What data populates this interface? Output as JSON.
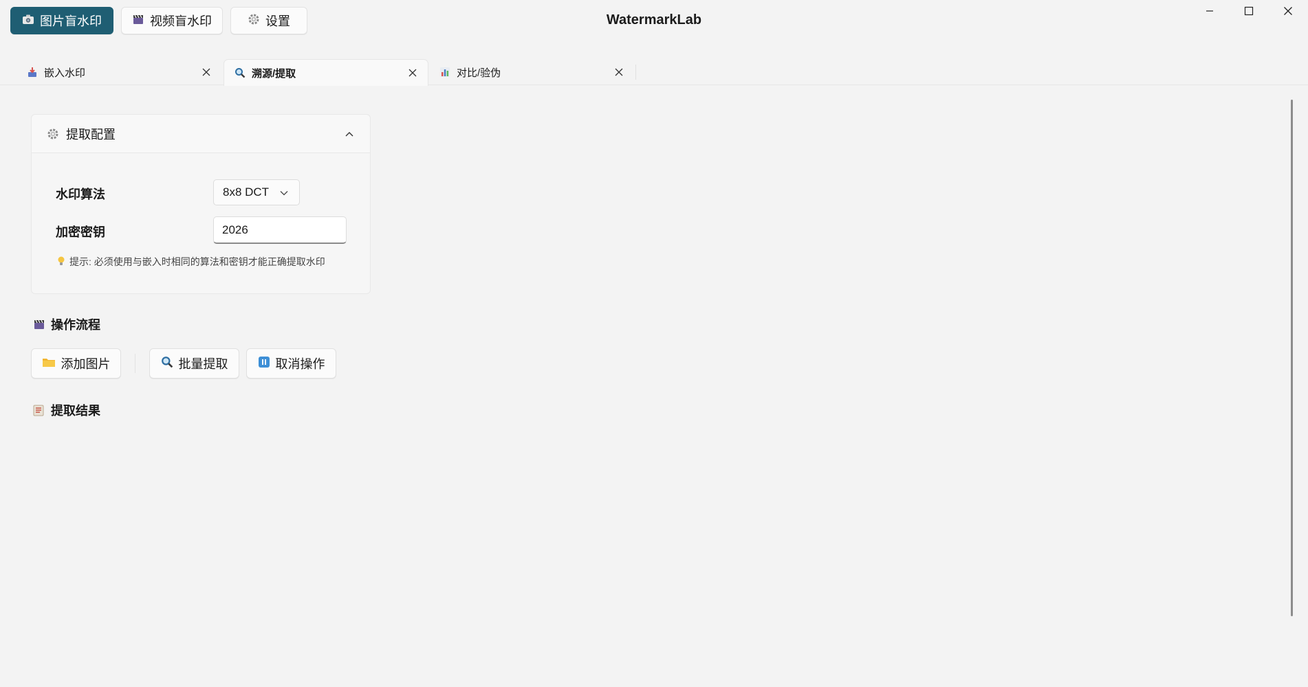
{
  "app": {
    "title": "WatermarkLab"
  },
  "modes": [
    {
      "label": "图片盲水印",
      "icon": "camera-icon",
      "active": true
    },
    {
      "label": "视频盲水印",
      "icon": "clapperboard-icon",
      "active": false
    },
    {
      "label": "设置",
      "icon": "gear-icon",
      "active": false
    }
  ],
  "tabs": [
    {
      "label": "嵌入水印",
      "icon": "inbox-arrow-icon",
      "active": false
    },
    {
      "label": "溯源/提取",
      "icon": "magnifier-icon",
      "active": true
    },
    {
      "label": "对比/验伪",
      "icon": "bar-chart-icon",
      "active": false
    }
  ],
  "config": {
    "title": "提取配置",
    "algorithm_label": "水印算法",
    "algorithm_value": "8x8 DCT",
    "key_label": "加密密钥",
    "key_value": "2026",
    "hint": "提示: 必须使用与嵌入时相同的算法和密钥才能正确提取水印"
  },
  "workflow": {
    "title": "操作流程",
    "add_label": "添加图片",
    "extract_label": "批量提取",
    "cancel_label": "取消操作"
  },
  "results": {
    "title": "提取结果"
  },
  "colors": {
    "accent": "#1f5e73",
    "background": "#f3f3f3"
  }
}
